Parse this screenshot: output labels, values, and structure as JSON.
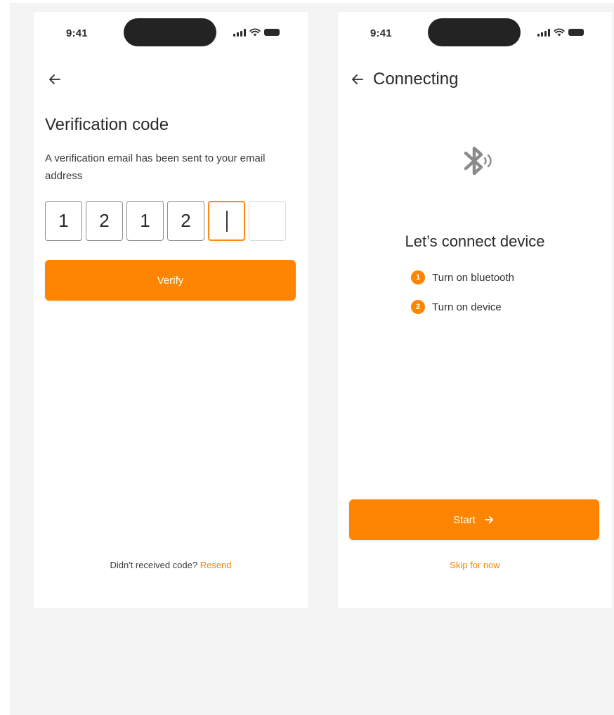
{
  "colors": {
    "accent": "#fd8501",
    "background": "#f4f4f4",
    "screen": "#ffffff",
    "text": "#2a2a2a"
  },
  "status_bar": {
    "time": "9:41",
    "icons": [
      "signal-icon",
      "wifi-icon",
      "battery-icon"
    ]
  },
  "verification_screen": {
    "back_icon": "arrow-left-icon",
    "title": "Verification code",
    "description": "A verification email has been sent to your email address",
    "code_digits": [
      "1",
      "2",
      "1",
      "2",
      "",
      ""
    ],
    "active_index": 4,
    "verify_label": "Verify",
    "resend_prompt": "Didn't received code?",
    "resend_link": "Resend"
  },
  "connecting_screen": {
    "back_icon": "arrow-left-icon",
    "title": "Connecting",
    "hero_icon": "bluetooth-icon",
    "heading": "Let’s connect device",
    "steps": [
      {
        "number": "1",
        "label": "Turn on bluetooth"
      },
      {
        "number": "2",
        "label": "Turn on device"
      }
    ],
    "start_label": "Start",
    "start_icon": "arrow-right-icon",
    "skip_label": "Skip for now"
  }
}
